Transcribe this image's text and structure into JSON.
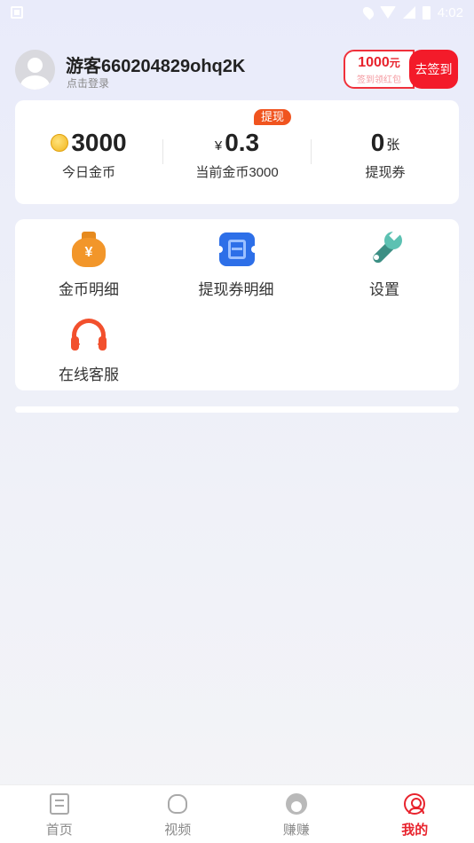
{
  "status_bar": {
    "time": "4:02"
  },
  "header": {
    "username": "游客660204829ohq2K",
    "login_hint": "点击登录",
    "checkin": {
      "amount": "1000",
      "amount_unit": "元",
      "subtitle": "签到领红包",
      "button": "去签到"
    }
  },
  "stats": {
    "badge": "提现",
    "items": [
      {
        "value": "3000",
        "prefix": "",
        "unit": "",
        "label": "今日金币",
        "icon": "coin-icon"
      },
      {
        "value": "0.3",
        "prefix": "¥",
        "unit": "",
        "label": "当前金币3000"
      },
      {
        "value": "0",
        "prefix": "",
        "unit": "张",
        "label": "提现券"
      }
    ]
  },
  "tools": [
    {
      "label": "金币明细",
      "icon": "money-bag-icon",
      "glyph": "¥"
    },
    {
      "label": "提现券明细",
      "icon": "ticket-icon"
    },
    {
      "label": "设置",
      "icon": "wrench-icon"
    },
    {
      "label": "在线客服",
      "icon": "headset-icon"
    }
  ],
  "nav": [
    {
      "label": "首页",
      "icon": "home-doc-icon"
    },
    {
      "label": "视频",
      "icon": "video-bag-icon"
    },
    {
      "label": "赚赚",
      "icon": "earn-face-icon"
    },
    {
      "label": "我的",
      "icon": "profile-icon",
      "active": true
    }
  ],
  "colors": {
    "accent": "#e8232d",
    "badge": "#f0541f",
    "coin": "#f2b51c"
  }
}
